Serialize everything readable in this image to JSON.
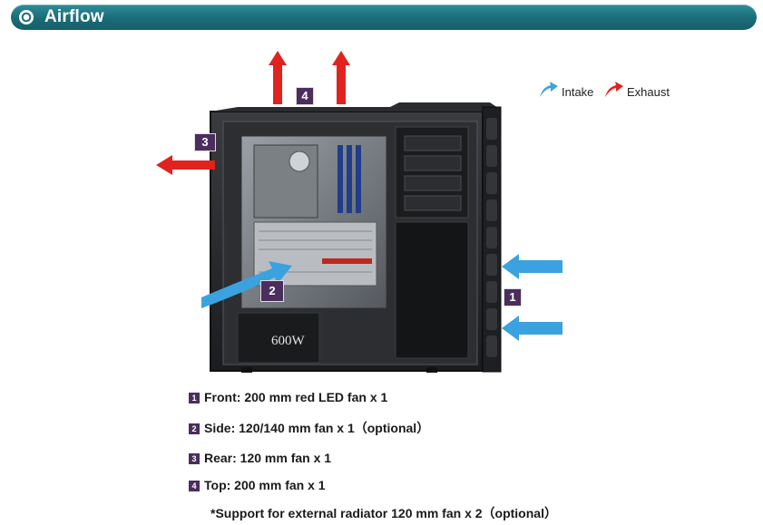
{
  "header": {
    "title": "Airflow"
  },
  "legend": {
    "intake_label": "Intake",
    "exhaust_label": "Exhaust",
    "intake_color": "#3aa2e0",
    "exhaust_color": "#e0231f"
  },
  "badges": {
    "front": "1",
    "side": "2",
    "rear": "3",
    "top": "4"
  },
  "psu_label": "600W",
  "specs": [
    {
      "num": "1",
      "label": "Front:",
      "text": " 200 mm red LED fan x 1"
    },
    {
      "num": "2",
      "label": "Side:",
      "text": " 120/140 mm fan x 1（optional）"
    },
    {
      "num": "3",
      "label": "Rear:",
      "text": " 120 mm fan x 1"
    },
    {
      "num": "4",
      "label": "Top:",
      "text": " 200 mm fan x 1"
    }
  ],
  "note": "*Support for external radiator 120 mm fan x 2（optional）"
}
